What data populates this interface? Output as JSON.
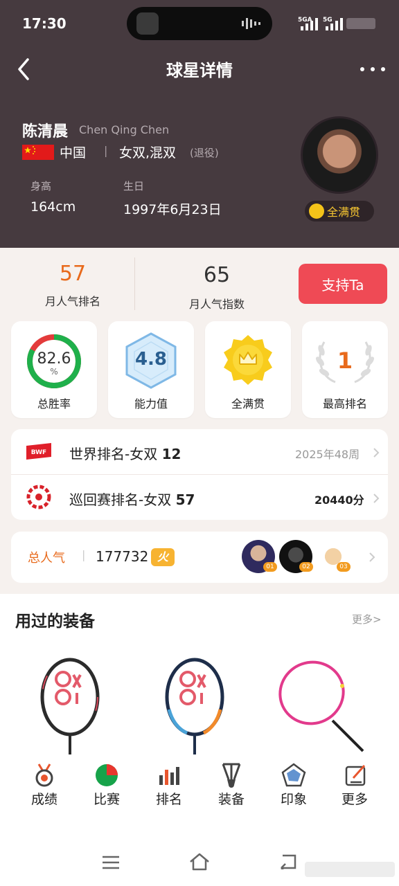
{
  "status_bar": {
    "time": "17:30",
    "net1": "5GA",
    "net2": "5G"
  },
  "header": {
    "title": "球星详情"
  },
  "player": {
    "name_cn": "陈清晨",
    "name_en": "Chen Qing Chen",
    "country": "中国",
    "separator": "|",
    "events": "女双,混双",
    "status": "(退役)",
    "height_label": "身高",
    "height": "164cm",
    "birthday_label": "生日",
    "birthday": "1997年6月23日",
    "badge": "全满贯"
  },
  "stats": {
    "rank_value": "57",
    "rank_label": "月人气排名",
    "index_value": "65",
    "index_label": "月人气指数",
    "support_button": "支持Ta"
  },
  "cards": {
    "win_rate": {
      "value": "82.6",
      "unit": "%",
      "label": "总胜率",
      "fraction": 0.826
    },
    "ability": {
      "value": "4.8",
      "label": "能力值"
    },
    "grand_slam": {
      "label": "全满贯"
    },
    "best_rank": {
      "value": "1",
      "label": "最高排名"
    }
  },
  "rankings": [
    {
      "logo": "BWF",
      "title": "世界排名-女双",
      "value": "12",
      "right": "2025年48周"
    },
    {
      "title": "巡回赛排名-女双",
      "value": "57",
      "right": "20440分"
    }
  ],
  "popularity": {
    "label": "总人气",
    "separator": "|",
    "value": "177732",
    "fire": "火",
    "fans": [
      {
        "tag": "01"
      },
      {
        "tag": "02"
      },
      {
        "tag": "03"
      }
    ]
  },
  "equipment": {
    "title": "用过的装备",
    "more": "更多>"
  },
  "bottom_nav": [
    {
      "label": "成绩",
      "icon": "medal-icon"
    },
    {
      "label": "比赛",
      "icon": "pie-chart-icon"
    },
    {
      "label": "排名",
      "icon": "bar-chart-icon"
    },
    {
      "label": "装备",
      "icon": "shuttlecock-icon"
    },
    {
      "label": "印象",
      "icon": "radar-icon"
    },
    {
      "label": "更多",
      "icon": "edit-icon"
    }
  ],
  "colors": {
    "header_bg": "#463a3f",
    "accent_orange": "#e86a1c",
    "support_red": "#ef4a55",
    "win_green": "#1fb04b",
    "win_red": "#e33b3b"
  }
}
